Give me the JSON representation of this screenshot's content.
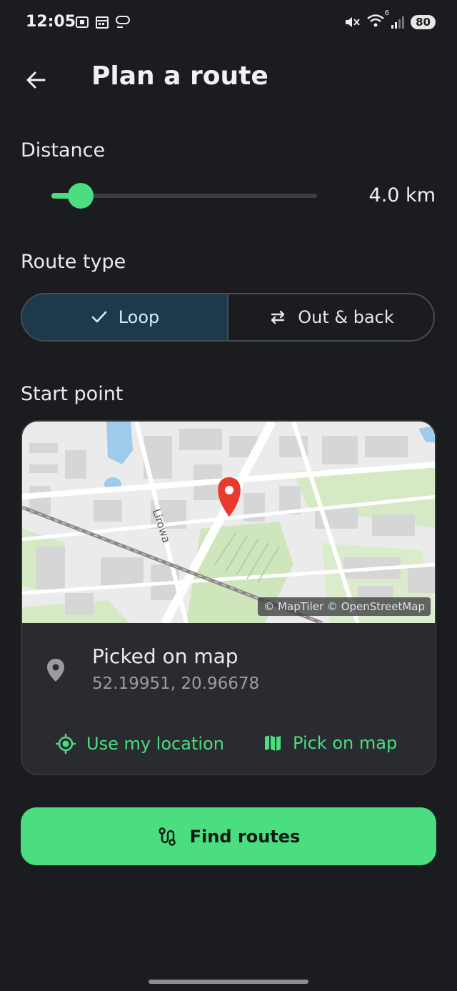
{
  "status_bar": {
    "time": "12:05",
    "battery": "80",
    "signal_badge": "6"
  },
  "header": {
    "title": "Plan a route"
  },
  "distance": {
    "label": "Distance",
    "value_text": "4.0 km",
    "slider_fraction": 0.11
  },
  "route_type": {
    "label": "Route type",
    "options": [
      {
        "label": "Loop",
        "selected": true
      },
      {
        "label": "Out & back",
        "selected": false
      }
    ]
  },
  "start_point": {
    "label": "Start point",
    "map": {
      "street_label": "Lirowa",
      "attribution": "© MapTiler © OpenStreetMap"
    },
    "place_title": "Picked on map",
    "coords": "52.19951, 20.96678",
    "actions": {
      "use_location": "Use my location",
      "pick_on_map": "Pick on map"
    }
  },
  "find_routes": {
    "label": "Find routes"
  },
  "colors": {
    "accent": "#4ade80",
    "background": "#1b1c20",
    "selected_segment": "#1d3a4c",
    "pin": "#ea3a2f"
  }
}
